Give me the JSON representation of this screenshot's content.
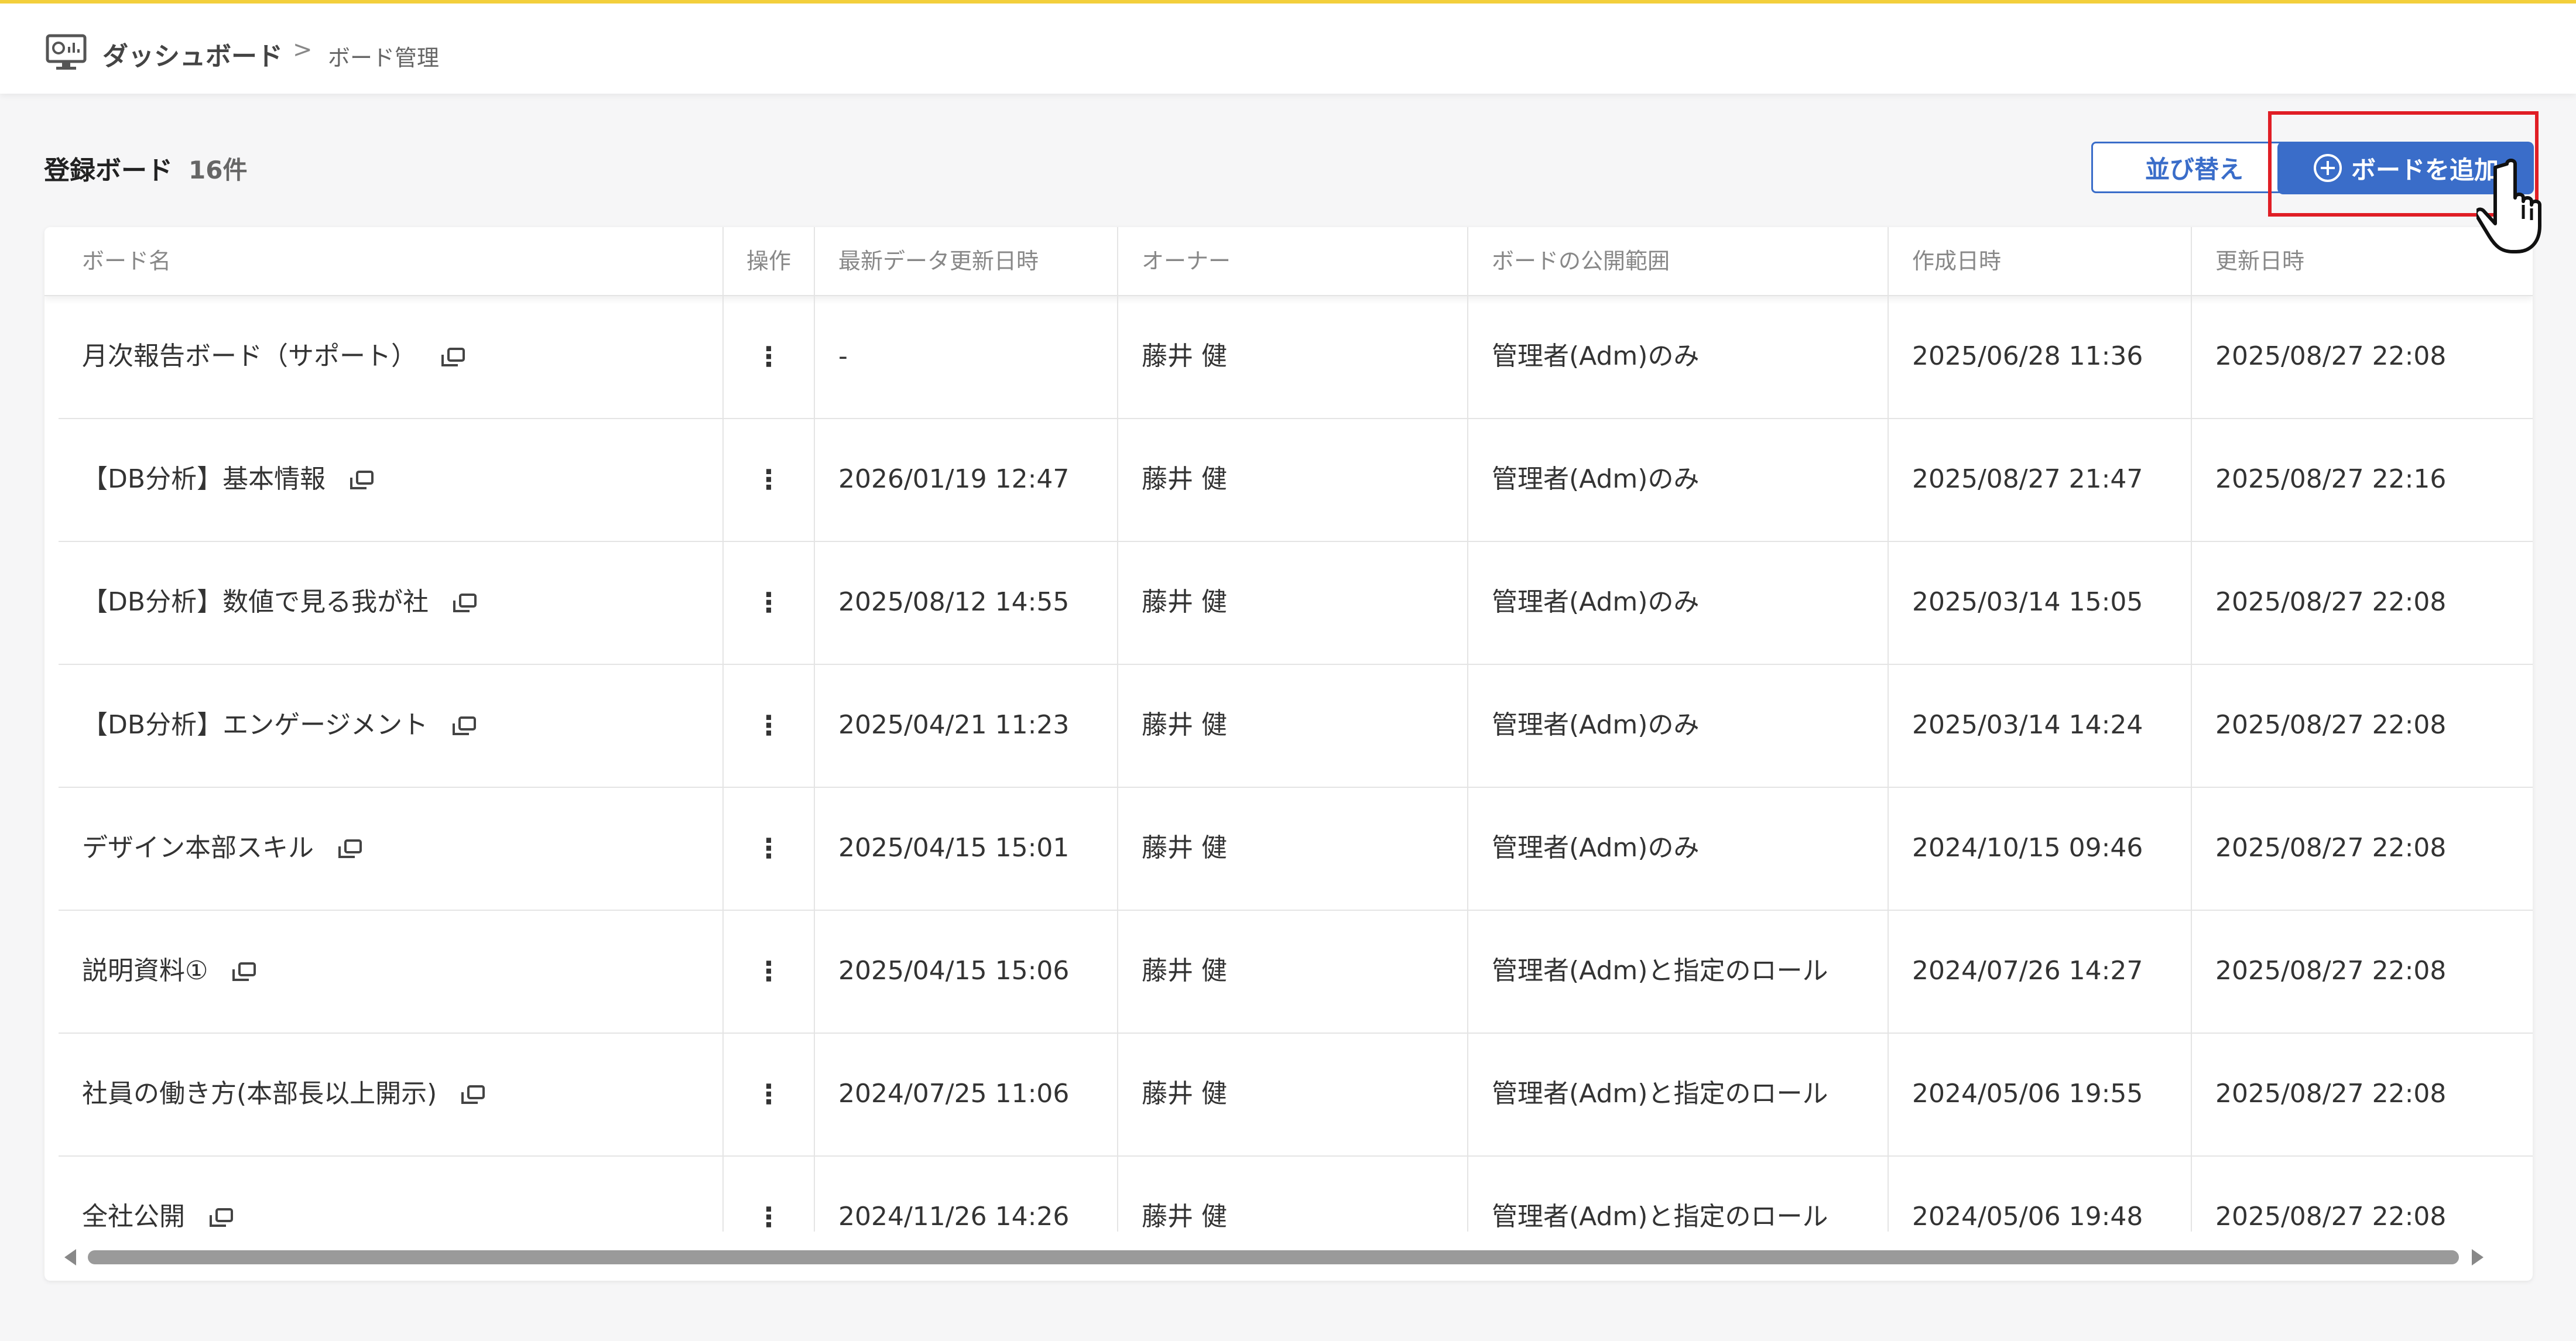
{
  "breadcrumb": {
    "home": "ダッシュボード",
    "separator": ">",
    "current": "ボード管理"
  },
  "header": {
    "title": "登録ボード",
    "count": "16件"
  },
  "actions": {
    "sort_label": "並び替え",
    "add_label": "ボードを追加"
  },
  "table": {
    "columns": [
      "ボード名",
      "操作",
      "最新データ更新日時",
      "オーナー",
      "ボードの公開範囲",
      "作成日時",
      "更新日時"
    ],
    "rows": [
      {
        "name": "月次報告ボード（サポート）",
        "ops": "⋮",
        "latest": "-",
        "owner": "藤井 健",
        "scope": "管理者(Adm)のみ",
        "created": "2025/06/28 11:36",
        "updated": "2025/08/27 22:08"
      },
      {
        "name": "【DB分析】基本情報",
        "ops": "⋮",
        "latest": "2026/01/19 12:47",
        "owner": "藤井 健",
        "scope": "管理者(Adm)のみ",
        "created": "2025/08/27 21:47",
        "updated": "2025/08/27 22:16"
      },
      {
        "name": "【DB分析】数値で見る我が社",
        "ops": "⋮",
        "latest": "2025/08/12 14:55",
        "owner": "藤井 健",
        "scope": "管理者(Adm)のみ",
        "created": "2025/03/14 15:05",
        "updated": "2025/08/27 22:08"
      },
      {
        "name": "【DB分析】エンゲージメント",
        "ops": "⋮",
        "latest": "2025/04/21 11:23",
        "owner": "藤井 健",
        "scope": "管理者(Adm)のみ",
        "created": "2025/03/14 14:24",
        "updated": "2025/08/27 22:08"
      },
      {
        "name": "デザイン本部スキル",
        "ops": "⋮",
        "latest": "2025/04/15 15:01",
        "owner": "藤井 健",
        "scope": "管理者(Adm)のみ",
        "created": "2024/10/15 09:46",
        "updated": "2025/08/27 22:08"
      },
      {
        "name": "説明資料①",
        "ops": "⋮",
        "latest": "2025/04/15 15:06",
        "owner": "藤井 健",
        "scope": "管理者(Adm)と指定のロール",
        "created": "2024/07/26 14:27",
        "updated": "2025/08/27 22:08"
      },
      {
        "name": "社員の働き方(本部長以上開示)",
        "ops": "⋮",
        "latest": "2024/07/25 11:06",
        "owner": "藤井 健",
        "scope": "管理者(Adm)と指定のロール",
        "created": "2024/05/06 19:55",
        "updated": "2025/08/27 22:08"
      },
      {
        "name": "全社公開",
        "ops": "⋮",
        "latest": "2024/11/26 14:26",
        "owner": "藤井 健",
        "scope": "管理者(Adm)と指定のロール",
        "created": "2024/05/06 19:48",
        "updated": "2025/08/27 22:08"
      }
    ]
  },
  "icons": {
    "breadcrumb": "dashboard-monitor-icon",
    "add": "plus-circle-icon",
    "row_link": "open-in-new-window-icon",
    "cursor": "hand-pointer-icon"
  },
  "colors": {
    "accent": "#3a6dc9",
    "highlight": "#e01e25",
    "topbar_border": "#f3cf3c"
  }
}
